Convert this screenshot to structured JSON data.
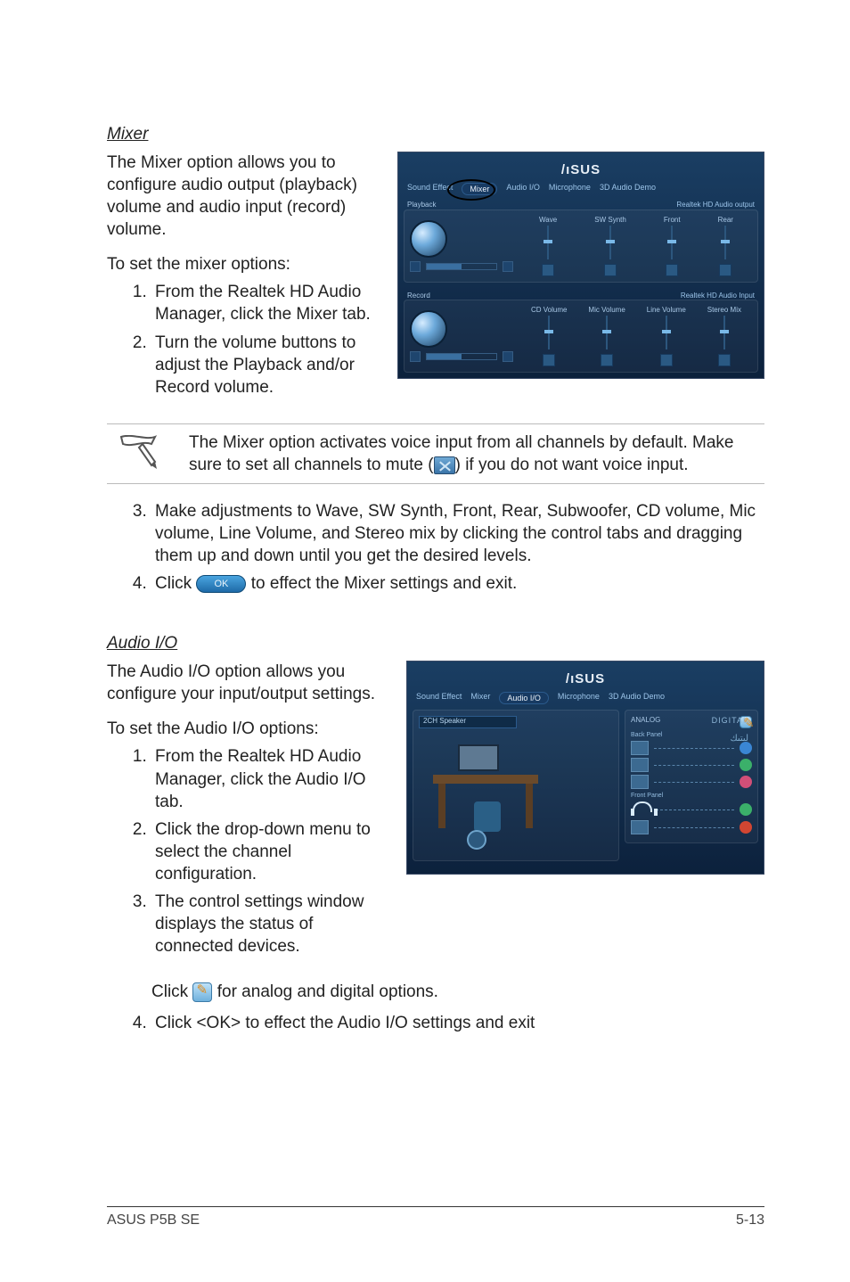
{
  "mixer": {
    "heading": "Mixer",
    "intro": "The Mixer option allows you to configure audio output (playback) volume and audio input (record) volume.",
    "lead": "To set the mixer options:",
    "steps": [
      "From the Realtek HD Audio Manager, click the Mixer tab.",
      "Turn the volume buttons to adjust the Playback and/or Record volume."
    ],
    "note_pre": "The Mixer option activates voice input from all channels by default. Make sure to set all channels to mute (",
    "note_post": ") if you do not want voice input.",
    "step3": "Make adjustments to Wave, SW Synth, Front, Rear, Subwoofer, CD volume, Mic volume, Line Volume, and Stereo mix by clicking the control tabs and dragging them up and down until you get the desired levels.",
    "step4_pre": "Click ",
    "step4_ok_label": "OK",
    "step4_post": " to effect the Mixer settings and exit.",
    "figure": {
      "brand": "/ıSUS",
      "tabs": [
        "Sound Effect",
        "Mixer",
        "Audio I/O",
        "Microphone",
        "3D Audio Demo"
      ],
      "active_tab": "Mixer",
      "playback_label": "Playback",
      "playback_device": "Realtek HD Audio output",
      "playback_sliders": [
        "Wave",
        "SW Synth",
        "Front",
        "Rear"
      ],
      "record_label": "Record",
      "record_device": "Realtek HD Audio Input",
      "record_sliders": [
        "CD Volume",
        "Mic Volume",
        "Line Volume",
        "Stereo Mix"
      ]
    }
  },
  "audioio": {
    "heading": "Audio I/O",
    "intro": "The Audio I/O option allows you configure your input/output settings.",
    "lead": "To set the Audio I/O options:",
    "steps": [
      "From the Realtek HD Audio Manager, click the Audio I/O tab.",
      "Click the drop-down menu to select the channel configuration."
    ],
    "step3_line1": "The control settings window displays the status of connected devices.",
    "step3_pre": "Click ",
    "step3_post": " for analog and digital options.",
    "step4": "Click <OK> to effect the Audio I/O settings and exit",
    "figure": {
      "brand": "/ıSUS",
      "tabs": [
        "Sound Effect",
        "Mixer",
        "Audio I/O",
        "Microphone",
        "3D Audio Demo"
      ],
      "active_tab": "Audio I/O",
      "dropdown": "2CH Speaker",
      "analog_label": "ANALOG",
      "back_panel_label": "Back Panel",
      "front_panel_label": "Front Panel",
      "digital_label": "DIGITAL",
      "brand_script": "لىتىك"
    }
  },
  "footer": {
    "left": "ASUS P5B SE",
    "right": "5-13"
  }
}
